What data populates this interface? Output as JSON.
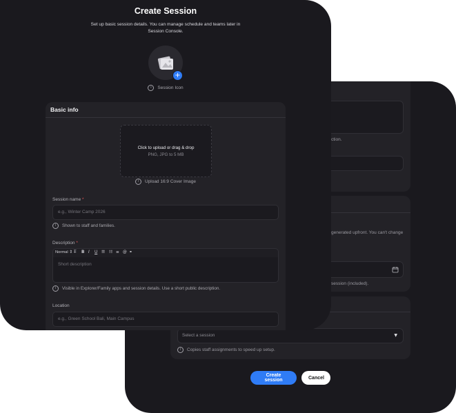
{
  "modal": {
    "title": "Create Session",
    "subtitle": "Set up basic session details. You can manage schedule and teams later in Session Console.",
    "icon_caption": "Session Icon",
    "basic_info": {
      "title": "Basic info",
      "upload_primary": "Click to upload or drag & drop",
      "upload_secondary": "PNG, JPG to 5 MB",
      "upload_caption": "Upload 16:9 Cover Image",
      "session_name_label": "Session name",
      "session_name_placeholder": "e.g., Winter Camp 2026",
      "session_name_help": "Shown to staff and families.",
      "description_label": "Description",
      "toolbar_normal": "Normal",
      "description_placeholder": "Short description",
      "description_help": "Visible in Explorer/Family apps and session details. Use a short public description.",
      "location_label": "Location",
      "location_placeholder": "e.g., Green School Bali, Main Campus"
    },
    "required_marker": "*"
  },
  "back": {
    "frag_ction": "ction.",
    "frag_generated": "generated upfront. You can't change",
    "frag_included": "session (included).",
    "select_placeholder": "Select a session",
    "copy_help": "Copies staff assignments to speed up setup.",
    "create_button": "Create session",
    "cancel_button": "Cancel"
  },
  "colors": {
    "accent": "#2f7cf6",
    "background": "#1a191e",
    "card": "#232227"
  }
}
